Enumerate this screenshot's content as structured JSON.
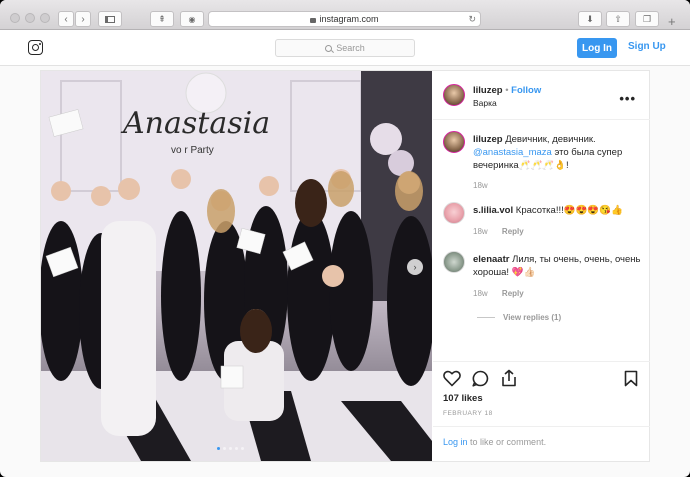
{
  "browser": {
    "url": "instagram.com"
  },
  "header": {
    "search_placeholder": "Search",
    "login_label": "Log In",
    "signup_label": "Sign Up"
  },
  "post": {
    "username": "liluzep",
    "separator": "•",
    "follow_label": "Follow",
    "location": "Варка",
    "more_label": "•••",
    "caption": {
      "username": "liluzep",
      "text_a": "Девичник, девичник.",
      "mention": "@anastasia_maza",
      "text_b": "это была супер вечеринка🥂🥂🥂👌!",
      "time": "18w"
    },
    "comments": [
      {
        "username": "s.lilia.vol",
        "text": "Красотка!!!😍😍😍😘👍",
        "time": "18w",
        "reply_label": "Reply"
      },
      {
        "username": "elenaatr",
        "text": "Лиля, ты очень, очень, очень хороша! 💖👍🏻",
        "time": "18w",
        "reply_label": "Reply"
      }
    ],
    "view_replies_label": "View replies (1)",
    "likes": "107 likes",
    "date": "FEBRUARY 18",
    "login_link": "Log in",
    "login_suffix": "to like or comment.",
    "photo_sign_text": "Anastasia",
    "photo_sign_sub": "vo    r Party"
  },
  "colors": {
    "accent": "#3897f0",
    "text": "#262626",
    "muted": "#999999"
  },
  "icons": [
    "back-arrow-icon",
    "forward-arrow-icon",
    "sidebar-icon",
    "lock-icon",
    "reload-icon",
    "download-icon",
    "share-icon",
    "tabs-icon",
    "instagram-logo-icon",
    "search-icon",
    "ellipsis-icon",
    "heart-icon",
    "comment-icon",
    "share-arrow-icon",
    "bookmark-icon",
    "next-arrow-icon"
  ]
}
